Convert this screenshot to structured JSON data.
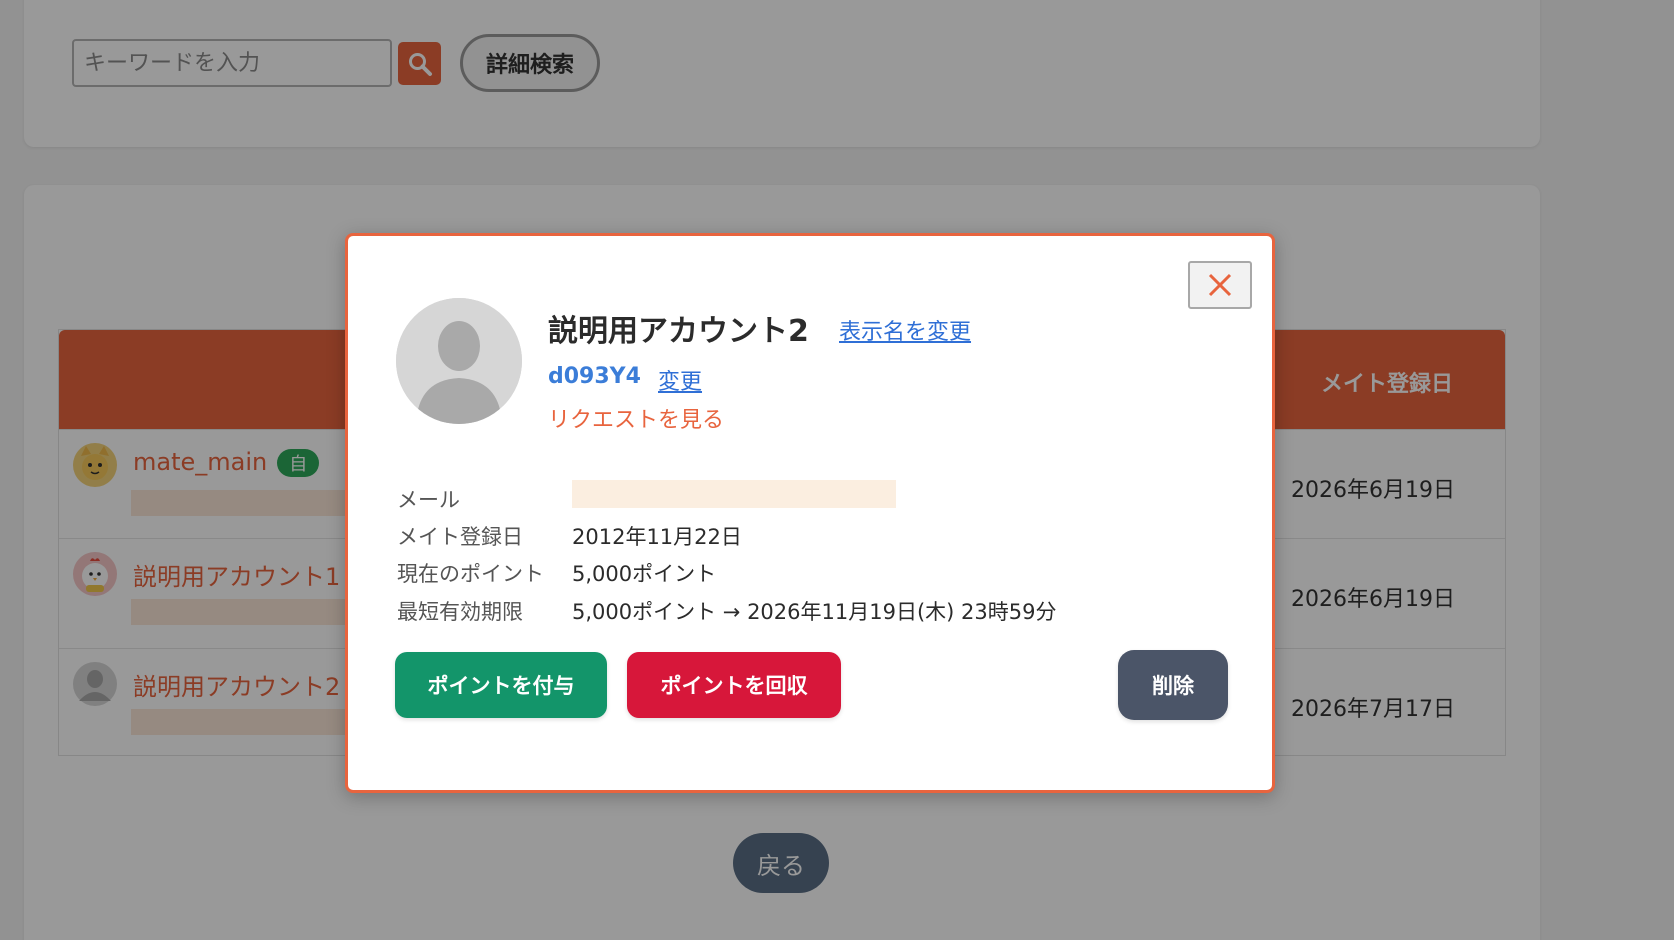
{
  "search": {
    "placeholder": "キーワードを入力",
    "detail_label": "詳細検索"
  },
  "table": {
    "date_header": "メイト登録日",
    "rows": [
      {
        "name": "mate_main",
        "badge": "自",
        "date": "2026年6月19日"
      },
      {
        "name": "説明用アカウント1",
        "date": "2026年6月19日"
      },
      {
        "name": "説明用アカウント2",
        "date": "2026年7月17日"
      }
    ]
  },
  "back_label": "戻る",
  "modal": {
    "name": "説明用アカウント2",
    "rename_label": "表示名を変更",
    "user_id": "d093Y4",
    "change_label": "変更",
    "request_label": "リクエストを見る",
    "info": {
      "email_label": "メール",
      "registered_label": "メイト登録日",
      "registered_value": "2012年11月22日",
      "points_label": "現在のポイント",
      "points_value": "5,000ポイント",
      "expiry_label": "最短有効期限",
      "expiry_value": "5,000ポイント → 2026年11月19日(木) 23時59分"
    },
    "grant_label": "ポイントを付与",
    "revoke_label": "ポイントを回収",
    "delete_label": "削除"
  },
  "colors": {
    "accent": "#e8643e",
    "grant": "#13956a",
    "revoke": "#d7173a",
    "delete": "#4b5568",
    "link": "#2f6fd6"
  },
  "icons": {
    "search": "search-icon",
    "close": "close-icon",
    "avatar": "default-avatar-icon"
  }
}
